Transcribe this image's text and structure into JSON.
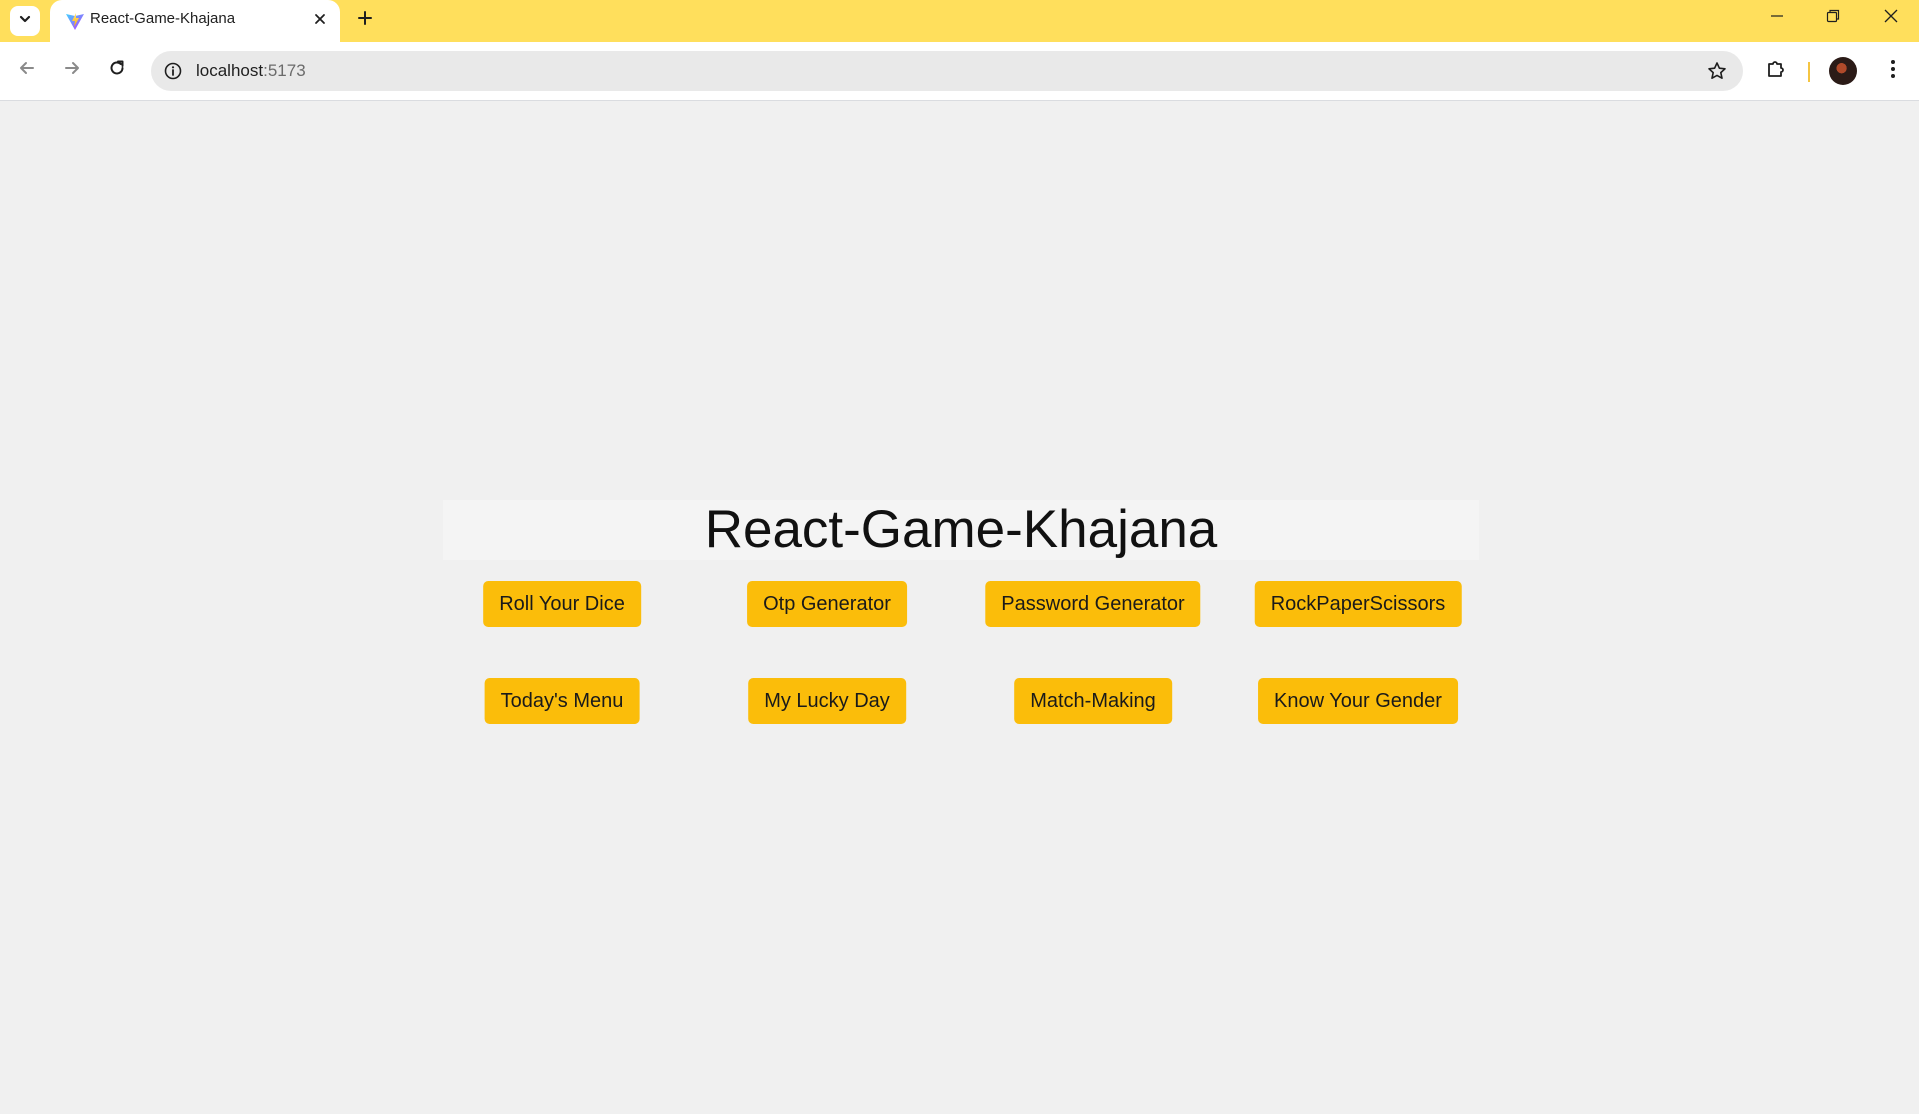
{
  "browser": {
    "tab": {
      "title": "React-Game-Khajana"
    },
    "address_bar": {
      "host": "localhost",
      "port": ":5173"
    },
    "accent_color": "#ffdf5c",
    "icons": {
      "tab_menu": "chevron-down-icon",
      "favicon": "vite-icon",
      "tab_close": "close-icon",
      "new_tab": "plus-icon",
      "back": "arrow-left-icon",
      "forward": "arrow-right-icon",
      "reload": "reload-icon",
      "site_info": "info-icon",
      "bookmark": "star-icon",
      "extensions": "puzzle-icon",
      "profile": "avatar",
      "menu": "kebab-icon"
    }
  },
  "page": {
    "title": "React-Game-Khajana",
    "button_color": "#fbbd0a",
    "buttons_row1": [
      {
        "label": "Roll Your Dice"
      },
      {
        "label": "Otp Generator"
      },
      {
        "label": "Password Generator"
      },
      {
        "label": "RockPaperScissors"
      }
    ],
    "buttons_row2": [
      {
        "label": "Today's Menu"
      },
      {
        "label": "My Lucky Day"
      },
      {
        "label": "Match-Making"
      },
      {
        "label": "Know Your Gender"
      }
    ]
  }
}
